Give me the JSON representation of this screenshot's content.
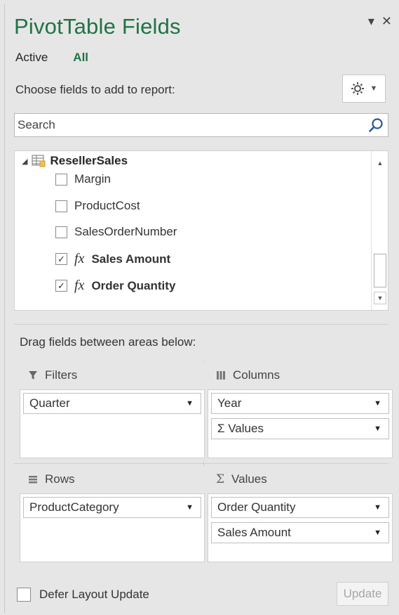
{
  "pane": {
    "title": "PivotTable Fields",
    "controls": {
      "dropdown_glyph": "▾",
      "close_glyph": "✕"
    },
    "accent_color": "#217346"
  },
  "tabs": {
    "active": "Active",
    "all": "All"
  },
  "choose_label": "Choose fields to add to report:",
  "settings_button": {
    "icon": "gear-icon"
  },
  "search": {
    "placeholder": "Search"
  },
  "field_list": {
    "table_name": "ResellerSales",
    "fields": [
      {
        "name": "Margin",
        "checked": false,
        "measure": false
      },
      {
        "name": "ProductCost",
        "checked": false,
        "measure": false
      },
      {
        "name": "SalesOrderNumber",
        "checked": false,
        "measure": false
      },
      {
        "name": "Sales Amount",
        "checked": true,
        "measure": true
      },
      {
        "name": "Order Quantity",
        "checked": true,
        "measure": true
      }
    ],
    "fx_glyph": "fx"
  },
  "drag_label": "Drag fields between areas below:",
  "areas": {
    "filters": {
      "label": "Filters",
      "items": [
        "Quarter"
      ]
    },
    "columns": {
      "label": "Columns",
      "items": [
        "Year",
        "Σ Values"
      ]
    },
    "rows": {
      "label": "Rows",
      "items": [
        "ProductCategory"
      ]
    },
    "values": {
      "label": "Values",
      "items": [
        "Order Quantity",
        "Sales Amount"
      ]
    }
  },
  "footer": {
    "defer_label": "Defer Layout Update",
    "defer_checked": false,
    "update_label": "Update"
  }
}
